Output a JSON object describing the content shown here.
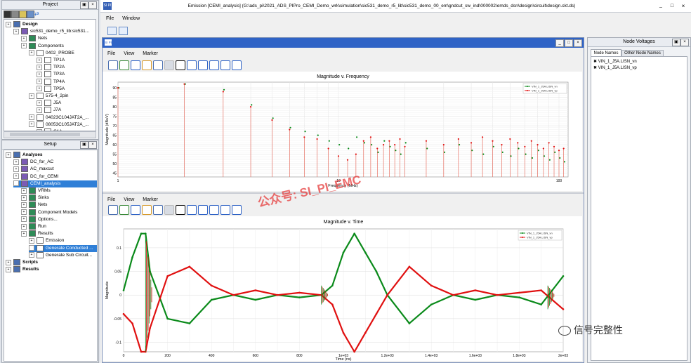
{
  "window": {
    "title": "Emission [CEMI_analysis] (G:\\ads_pi\\2021_ADS_PIPro_CEMI_Demo_wrk\\simulation\\sic531_demo_r5_lib\\sic531_demo_00_em\\gndcut_sw_ind\\000002\\emds_dsn\\design\\circuit\\design.ckt.ds)",
    "logo": "SI PI",
    "min_label": "_",
    "max_label": "□",
    "close_label": "×"
  },
  "menu": {
    "file": "File",
    "window": "Window"
  },
  "project": {
    "title": "Project",
    "items": [
      {
        "label": "Design",
        "level": 0
      },
      {
        "label": "sic531_demo_r5_lib:sic531...",
        "level": 1
      },
      {
        "label": "Nets",
        "level": 2
      },
      {
        "label": "Components",
        "level": 2
      },
      {
        "label": "0402_PROBE",
        "level": 3
      },
      {
        "label": "TP1A",
        "level": 4
      },
      {
        "label": "TP2A",
        "level": 4
      },
      {
        "label": "TP3A",
        "level": 4
      },
      {
        "label": "TP4A",
        "level": 4
      },
      {
        "label": "TP5A",
        "level": 4
      },
      {
        "label": "575-4_2pin",
        "level": 3
      },
      {
        "label": "J5A",
        "level": 4
      },
      {
        "label": "J7A",
        "level": 4
      },
      {
        "label": "04023C104JAT2A_...",
        "level": 3
      },
      {
        "label": "08053C105JAT2A_...",
        "level": 3
      },
      {
        "label": "C1A",
        "level": 4
      }
    ]
  },
  "setup": {
    "title": "Setup",
    "items": [
      {
        "label": "Analyses",
        "level": 0
      },
      {
        "label": "DC_for_AC",
        "level": 1
      },
      {
        "label": "AC_maxcut",
        "level": 1
      },
      {
        "label": "DC_for_CEMI",
        "level": 1
      },
      {
        "label": "CEMI_analysis",
        "level": 1
      },
      {
        "label": "VRMs",
        "level": 2
      },
      {
        "label": "Sinks",
        "level": 2
      },
      {
        "label": "Nets",
        "level": 2
      },
      {
        "label": "Component Models",
        "level": 2
      },
      {
        "label": "Options...",
        "level": 2
      },
      {
        "label": "Run",
        "level": 2
      },
      {
        "label": "Results",
        "level": 2
      },
      {
        "label": "Emission",
        "level": 3
      },
      {
        "label": "Generate Conducted ...",
        "level": 3
      },
      {
        "label": "Generate Sub Circuit...",
        "level": 3
      },
      {
        "label": "Scripts",
        "level": 0
      },
      {
        "label": "Results",
        "level": 0
      }
    ]
  },
  "plots": {
    "menu": {
      "file": "File",
      "view": "View",
      "marker": "Marker"
    },
    "freq": {
      "title": "Magnitude v. Frequency",
      "xlabel": "Frequency (MHz)",
      "ylabel": "Magnitude (dBuV)"
    },
    "time": {
      "title": "Magnitude v. Time",
      "xlabel": "Time (ns)",
      "ylabel": "Magnitude"
    }
  },
  "legend": {
    "vn": "VIN_1_J5A.LISN_vn",
    "vp": "VIN_1_J5A.LISN_vp"
  },
  "node_voltages": {
    "title": "Node Voltages",
    "tab1": "Node Names",
    "tab2": "Other Node Names",
    "items": [
      "VIN_1_J5A.LISN_vn",
      "VIN_1_J5A.LISN_vp"
    ]
  },
  "watermark": {
    "text": "公众号: SI_PI_EMC",
    "brand": "信号完整性"
  },
  "colors": {
    "green": "#0a8a1a",
    "red": "#e01010",
    "select": "#2f7fd7"
  },
  "chart_data": [
    {
      "type": "scatter",
      "title": "Magnitude v. Frequency",
      "xlabel": "Frequency (MHz)",
      "ylabel": "Magnitude (dBuV)",
      "xscale": "log",
      "xlim": [
        1,
        110
      ],
      "ylim": [
        43,
        93
      ],
      "xticks": [
        "1",
        "10",
        "100"
      ],
      "yticks": [
        "45",
        "50",
        "55",
        "60",
        "65",
        "70",
        "75",
        "80",
        "85",
        "90"
      ],
      "series": [
        {
          "name": "VIN_1_J5A.LISN_vn",
          "x": [
            1,
            2,
            3,
            4,
            5,
            6,
            7,
            8,
            9,
            10,
            11,
            12,
            13,
            14,
            15,
            16,
            17,
            18,
            19,
            20,
            25,
            30,
            35,
            40,
            45,
            50,
            55,
            60,
            65,
            70,
            75,
            80,
            85,
            90,
            95,
            100,
            105
          ],
          "y": [
            90,
            92,
            89,
            81,
            74,
            69,
            67,
            65,
            62,
            60,
            58,
            64,
            61,
            60,
            56,
            62,
            59,
            57,
            55,
            61,
            58,
            56,
            60,
            57,
            55,
            59,
            56,
            54,
            58,
            55,
            53,
            57,
            54,
            52,
            56,
            53,
            51
          ]
        },
        {
          "name": "VIN_1_J5A.LISN_vp",
          "x": [
            1,
            2,
            3,
            4,
            5,
            6,
            7,
            8,
            9,
            10,
            11,
            12,
            13,
            14,
            15,
            16,
            17,
            18,
            19,
            20,
            25,
            30,
            35,
            40,
            45,
            50,
            55,
            60,
            65,
            70,
            75,
            80,
            85,
            90,
            95,
            100,
            105
          ],
          "y": [
            90,
            92,
            88,
            80,
            73,
            68,
            64,
            63,
            58,
            54,
            52,
            55,
            62,
            64,
            58,
            60,
            62,
            60,
            63,
            59,
            62,
            60,
            63,
            61,
            64,
            62,
            60,
            63,
            61,
            59,
            62,
            60,
            58,
            61,
            59,
            57,
            58
          ]
        }
      ],
      "legend": "top-right",
      "grid": true
    },
    {
      "type": "line",
      "title": "Magnitude v. Time",
      "xlabel": "Time (ns)",
      "ylabel": "Magnitude",
      "xlim": [
        0,
        2000
      ],
      "ylim": [
        -0.12,
        0.14
      ],
      "xticks": [
        "0",
        "200",
        "400",
        "600",
        "800",
        "1e+03",
        "1.2e+03",
        "1.4e+03",
        "1.6e+03",
        "1.8e+03",
        "2e+03"
      ],
      "yticks": [
        "-0.1",
        "-0.05",
        "0",
        "0.05",
        "0.1"
      ],
      "series": [
        {
          "name": "VIN_1_J5A.LISN_vn",
          "x": [
            0,
            40,
            80,
            100,
            120,
            200,
            300,
            400,
            500,
            600,
            700,
            800,
            900,
            950,
            1000,
            1050,
            1100,
            1150,
            1200,
            1300,
            1400,
            1500,
            1600,
            1700,
            1800,
            1900,
            1950,
            2000
          ],
          "y": [
            0.01,
            0.08,
            0.13,
            0.13,
            0.05,
            -0.05,
            -0.06,
            -0.01,
            0.0,
            -0.01,
            0.0,
            -0.005,
            0.0,
            0.02,
            0.09,
            0.13,
            0.09,
            0.05,
            0.0,
            -0.06,
            -0.02,
            0.0,
            -0.01,
            0.0,
            -0.005,
            -0.02,
            0.01,
            0.04
          ]
        },
        {
          "name": "VIN_1_J5A.LISN_vp",
          "x": [
            0,
            40,
            80,
            100,
            120,
            200,
            300,
            400,
            500,
            600,
            700,
            800,
            900,
            950,
            1000,
            1050,
            1100,
            1150,
            1200,
            1300,
            1400,
            1500,
            1600,
            1700,
            1800,
            1900,
            1950,
            2000
          ],
          "y": [
            -0.04,
            -0.06,
            -0.12,
            -0.12,
            -0.07,
            0.04,
            0.06,
            0.02,
            0.0,
            0.01,
            0.0,
            0.005,
            0.0,
            -0.02,
            -0.08,
            -0.12,
            -0.08,
            -0.04,
            0.0,
            0.06,
            0.02,
            0.0,
            0.01,
            0.0,
            0.005,
            0.01,
            -0.01,
            -0.03
          ]
        }
      ],
      "legend": "top-right",
      "grid": true
    }
  ]
}
